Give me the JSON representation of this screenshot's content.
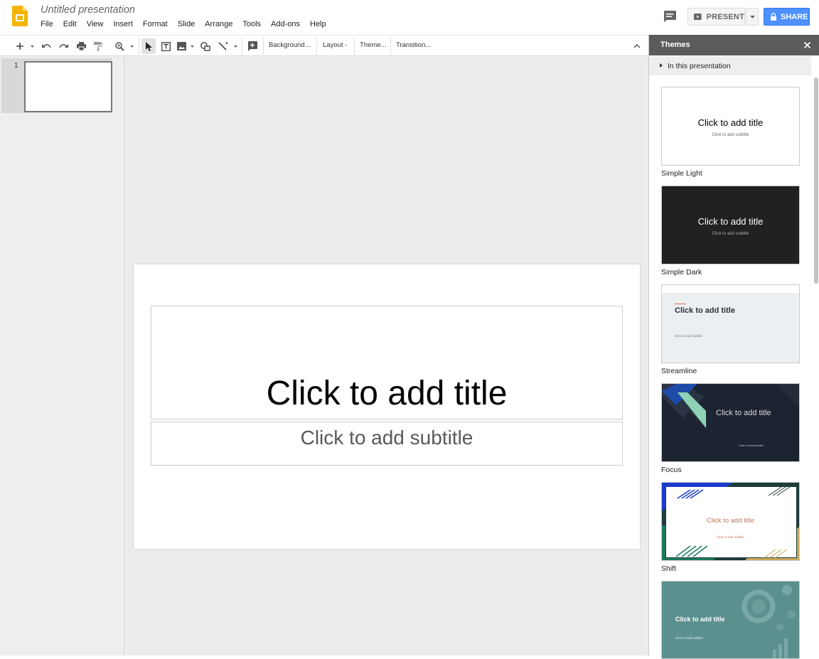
{
  "app": {
    "doc_title": "Untitled presentation",
    "menus": [
      "File",
      "Edit",
      "View",
      "Insert",
      "Format",
      "Slide",
      "Arrange",
      "Tools",
      "Add-ons",
      "Help"
    ],
    "present_label": "PRESENT",
    "share_label": "SHARE",
    "brand_color": "#f4b400",
    "share_color": "#4d90fe"
  },
  "toolbar": {
    "background_label": "Background...",
    "layout_label": "Layout -",
    "theme_label": "Theme...",
    "transition_label": "Transition..."
  },
  "filmstrip": {
    "slides": [
      {
        "number": "1"
      }
    ]
  },
  "slide": {
    "title_placeholder": "Click to add title",
    "subtitle_placeholder": "Click to add subtitle"
  },
  "themes_panel": {
    "heading": "Themes",
    "section_label": "In this presentation",
    "themes": [
      {
        "name": "Simple Light",
        "title": "Click to add title",
        "subtitle": "Click to add subtitle",
        "bg": "#ffffff",
        "fg": "#000000"
      },
      {
        "name": "Simple Dark",
        "title": "Click to add title",
        "subtitle": "Click to add subtitle",
        "bg": "#212121",
        "fg": "#ffffff"
      },
      {
        "name": "Streamline",
        "title": "Click to add title",
        "subtitle": "Click to add subtitle",
        "bg": "#eceff1",
        "fg": "#263238"
      },
      {
        "name": "Focus",
        "title": "Click to add title",
        "subtitle": "Click to add subtitle",
        "bg": "#1c2331",
        "fg": "#ffffff"
      },
      {
        "name": "Shift",
        "title": "Click to add title",
        "subtitle": "Click to add subtitle",
        "bg": "#ffffff",
        "fg": "#c0785a"
      },
      {
        "name": "",
        "title": "Click to add title",
        "subtitle": "Click to add subtitle",
        "bg": "#5b908f",
        "fg": "#ffffff"
      }
    ]
  }
}
